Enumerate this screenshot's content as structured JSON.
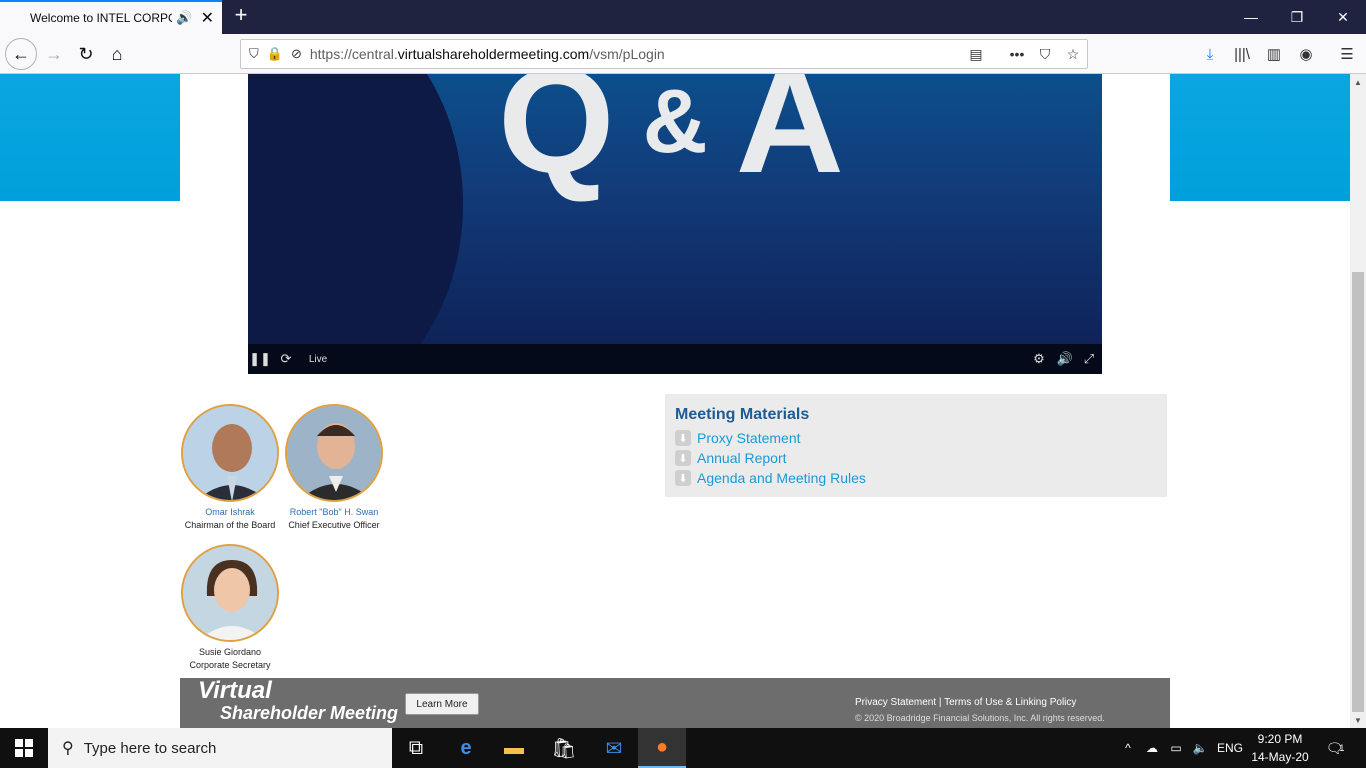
{
  "browser": {
    "tab_title": "Welcome to INTEL CORPOR",
    "url_prefix": "https://central.",
    "url_domain": "virtualshareholdermeeting.com",
    "url_path": "/vsm/pLogin"
  },
  "video": {
    "big_q": "Q",
    "big_amp": "&",
    "big_a": "A",
    "live_label": "Live"
  },
  "people": [
    {
      "name": "Omar Ishrak",
      "role": "Chairman of the Board"
    },
    {
      "name": "Robert \"Bob\" H. Swan",
      "role": "Chief Executive Officer"
    },
    {
      "name": "Susie Giordano",
      "role": "Corporate Secretary"
    }
  ],
  "materials": {
    "heading": "Meeting Materials",
    "items": [
      "Proxy Statement",
      "Annual Report",
      "Agenda and Meeting Rules"
    ]
  },
  "footer": {
    "logo_line1": "Virtual",
    "logo_line2": "Shareholder Meeting",
    "learn_more": "Learn More",
    "links": "Privacy Statement | Terms of Use & Linking Policy",
    "copyright": "© 2020 Broadridge Financial Solutions, Inc. All rights reserved."
  },
  "taskbar": {
    "search_placeholder": "Type here to search",
    "lang": "ENG",
    "time": "9:20 PM",
    "date": "14-May-20",
    "notif_count": "1"
  },
  "colors": {
    "accent_blue": "#00a0dc",
    "heading_blue": "#1f5c96",
    "link_blue": "#1a9ad6",
    "footer_gray": "#6d6d6d"
  }
}
